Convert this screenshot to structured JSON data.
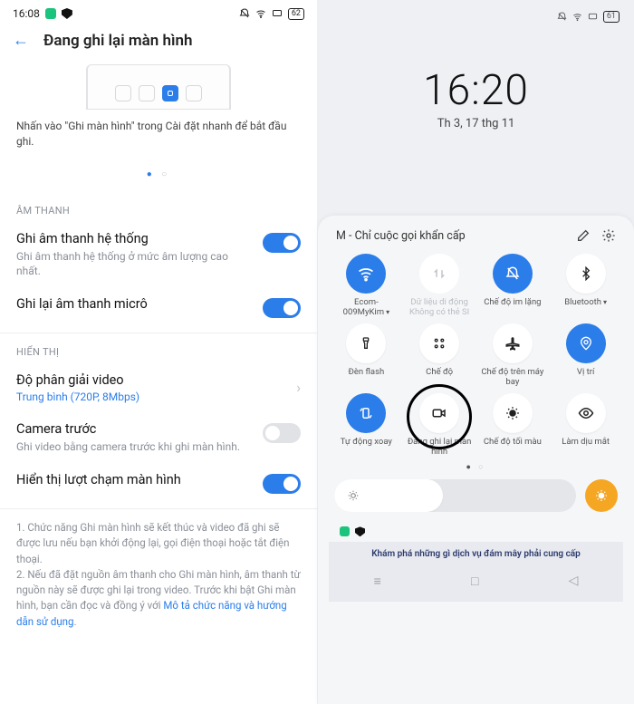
{
  "left": {
    "status": {
      "time": "16:08",
      "battery": "62"
    },
    "header": {
      "title": "Đang ghi lại màn hình"
    },
    "hint": "Nhấn vào \"Ghi màn hình\" trong Cài đặt nhanh để bắt đầu ghi.",
    "sections": {
      "sound": {
        "header": "ÂM THANH",
        "system": {
          "title": "Ghi âm thanh hệ thống",
          "sub": "Ghi âm thanh hệ thống ở mức âm lượng cao nhất."
        },
        "mic": {
          "title": "Ghi lại âm thanh micrô"
        }
      },
      "display": {
        "header": "HIỂN THỊ",
        "resolution": {
          "title": "Độ phân giải video",
          "sub": "Trung bình (720P, 8Mbps)"
        },
        "frontcam": {
          "title": "Camera trước",
          "sub": "Ghi video bằng camera trước khi ghi màn hình."
        },
        "touches": {
          "title": "Hiển thị lượt chạm màn hình"
        }
      }
    },
    "footnotes": {
      "n1": "1. Chức năng Ghi màn hình sẽ kết thúc và video đã ghi sẽ được lưu nếu bạn khởi động lại, gọi điện thoại hoặc tắt điện thoại.",
      "n2a": "2. Nếu đã đặt nguồn âm thanh cho Ghi màn hình, âm thanh từ nguồn này sẽ được ghi lại trong video. Trước khi bật Ghi màn hình, bạn cần đọc và đồng ý với ",
      "link": "Mô tả chức năng và hướng dẫn sử dụng",
      "n2b": "."
    }
  },
  "right": {
    "status": {
      "battery": "61",
      "time": "16:20",
      "date": "Th 3, 17 thg 11"
    },
    "carrier": "M - Chỉ cuộc gọi khẩn cấp",
    "tiles": {
      "wifi": {
        "label": "Ecom-009MyKim"
      },
      "data": {
        "label": "Dữ liệu di động",
        "sub": "Không có thẻ SI"
      },
      "silent": {
        "label": "Chế độ im lặng"
      },
      "bt": {
        "label": "Bluetooth"
      },
      "flash": {
        "label": "Đèn flash"
      },
      "mode": {
        "label": "Chế độ"
      },
      "airplane": {
        "label": "Chế độ trên máy bay"
      },
      "location": {
        "label": "Vị trí"
      },
      "rotate": {
        "label": "Tự động xoay"
      },
      "record": {
        "label": "Đang ghi lại màn hình"
      },
      "dark": {
        "label": "Chế độ tối màu"
      },
      "eye": {
        "label": "Làm dịu mắt"
      }
    },
    "bottom_banner": "Khám phá những gì dịch vụ đám mây phải cung cấp"
  }
}
